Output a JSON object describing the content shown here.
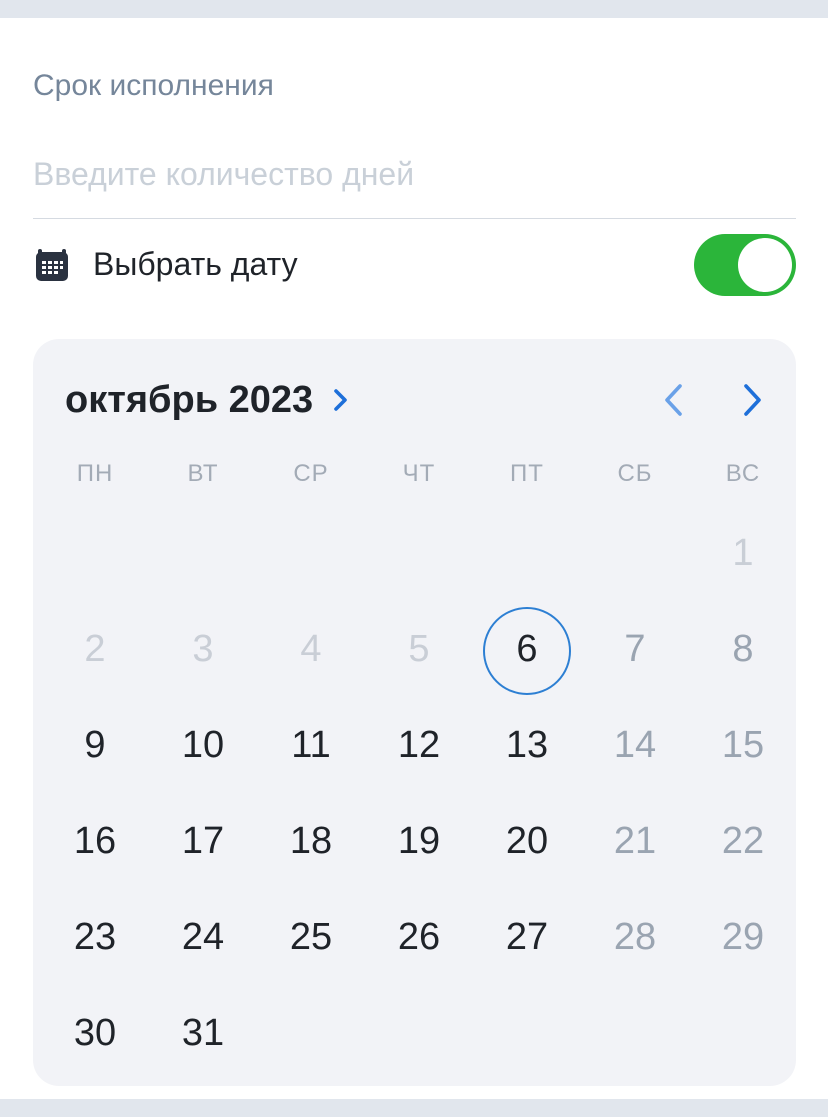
{
  "form": {
    "deadline_label": "Срок исполнения",
    "days_placeholder": "Введите количество дней",
    "pick_date_label": "Выбрать дату",
    "pick_date_enabled": true
  },
  "colors": {
    "accent": "#2d7fd3",
    "toggle_on": "#2bb53a"
  },
  "calendar": {
    "month_title": "октябрь 2023",
    "weekdays": [
      "ПН",
      "ВТ",
      "СР",
      "ЧТ",
      "ПТ",
      "СБ",
      "ВС"
    ],
    "selected_day": "6",
    "days": [
      {
        "n": "1",
        "state": "past"
      },
      {
        "n": "2",
        "state": "past"
      },
      {
        "n": "3",
        "state": "past"
      },
      {
        "n": "4",
        "state": "past"
      },
      {
        "n": "5",
        "state": "past"
      },
      {
        "n": "6",
        "state": "active"
      },
      {
        "n": "7",
        "state": "weekend"
      },
      {
        "n": "8",
        "state": "weekend"
      },
      {
        "n": "9",
        "state": "active"
      },
      {
        "n": "10",
        "state": "active"
      },
      {
        "n": "11",
        "state": "active"
      },
      {
        "n": "12",
        "state": "active"
      },
      {
        "n": "13",
        "state": "active"
      },
      {
        "n": "14",
        "state": "weekend"
      },
      {
        "n": "15",
        "state": "weekend"
      },
      {
        "n": "16",
        "state": "active"
      },
      {
        "n": "17",
        "state": "active"
      },
      {
        "n": "18",
        "state": "active"
      },
      {
        "n": "19",
        "state": "active"
      },
      {
        "n": "20",
        "state": "active"
      },
      {
        "n": "21",
        "state": "weekend"
      },
      {
        "n": "22",
        "state": "weekend"
      },
      {
        "n": "23",
        "state": "active"
      },
      {
        "n": "24",
        "state": "active"
      },
      {
        "n": "25",
        "state": "active"
      },
      {
        "n": "26",
        "state": "active"
      },
      {
        "n": "27",
        "state": "active"
      },
      {
        "n": "28",
        "state": "weekend"
      },
      {
        "n": "29",
        "state": "weekend"
      },
      {
        "n": "30",
        "state": "active"
      },
      {
        "n": "31",
        "state": "active"
      }
    ]
  }
}
